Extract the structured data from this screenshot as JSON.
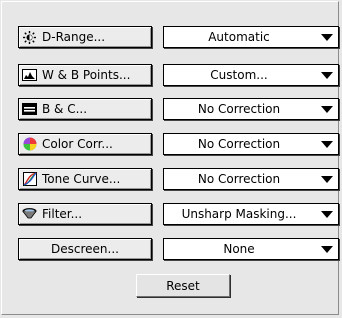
{
  "rows": [
    {
      "button": "D-Range...",
      "icon": "contrast-sun-icon",
      "select": "Automatic"
    },
    {
      "button": "W & B Points...",
      "icon": "histogram-icon",
      "select": "Custom..."
    },
    {
      "button": "B & C...",
      "icon": "brightness-contrast-icon",
      "select": "No Correction"
    },
    {
      "button": "Color Corr...",
      "icon": "color-wheel-icon",
      "select": "No Correction"
    },
    {
      "button": "Tone Curve...",
      "icon": "tone-curve-icon",
      "select": "No Correction"
    },
    {
      "button": "Filter...",
      "icon": "filter-icon",
      "select": "Unsharp Masking..."
    },
    {
      "button": "Descreen...",
      "icon": "",
      "select": "None"
    }
  ],
  "reset_label": "Reset"
}
